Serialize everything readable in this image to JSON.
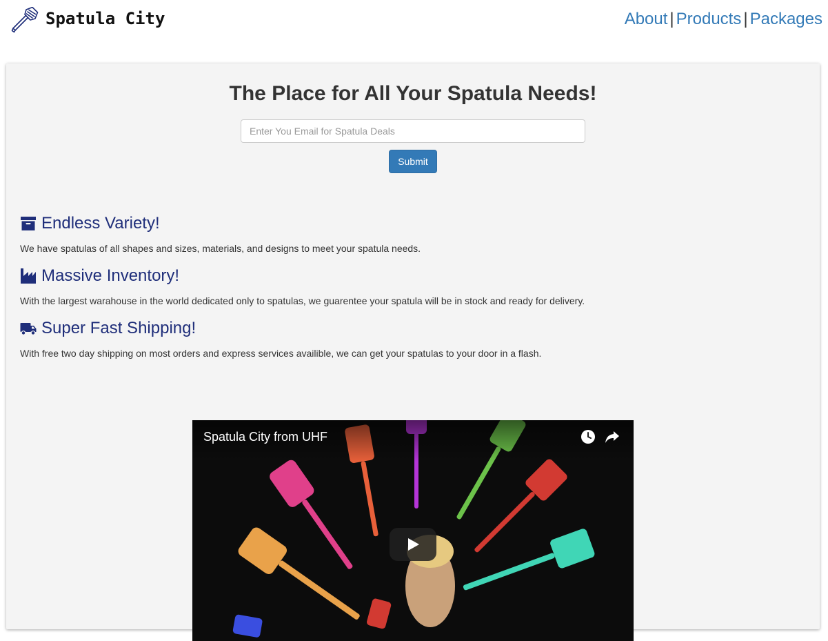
{
  "header": {
    "brand": "Spatula City",
    "nav": [
      {
        "label": "About"
      },
      {
        "label": "Products"
      },
      {
        "label": "Packages"
      }
    ],
    "separator": "|"
  },
  "hero": {
    "title": "The Place for All Your Spatula Needs!",
    "email_placeholder": "Enter You Email for Spatula Deals",
    "submit_label": "Submit"
  },
  "features": [
    {
      "icon": "archive-box-icon",
      "title": "Endless Variety!",
      "text": "We have spatulas of all shapes and sizes, materials, and designs to meet your spatula needs."
    },
    {
      "icon": "factory-icon",
      "title": "Massive Inventory!",
      "text": "With the largest warahouse in the world dedicated only to spatulas, we guarentee your spatula will be in stock and ready for delivery."
    },
    {
      "icon": "truck-icon",
      "title": "Super Fast Shipping!",
      "text": "With free two day shipping on most orders and express services availible, we can get your spatulas to your door in a flash."
    }
  ],
  "video": {
    "title": "Spatula City from UHF"
  },
  "colors": {
    "link": "#337ab7",
    "feature_heading": "#1f2e7a",
    "panel_background": "#f4f4f4",
    "button": "#337ab7"
  }
}
